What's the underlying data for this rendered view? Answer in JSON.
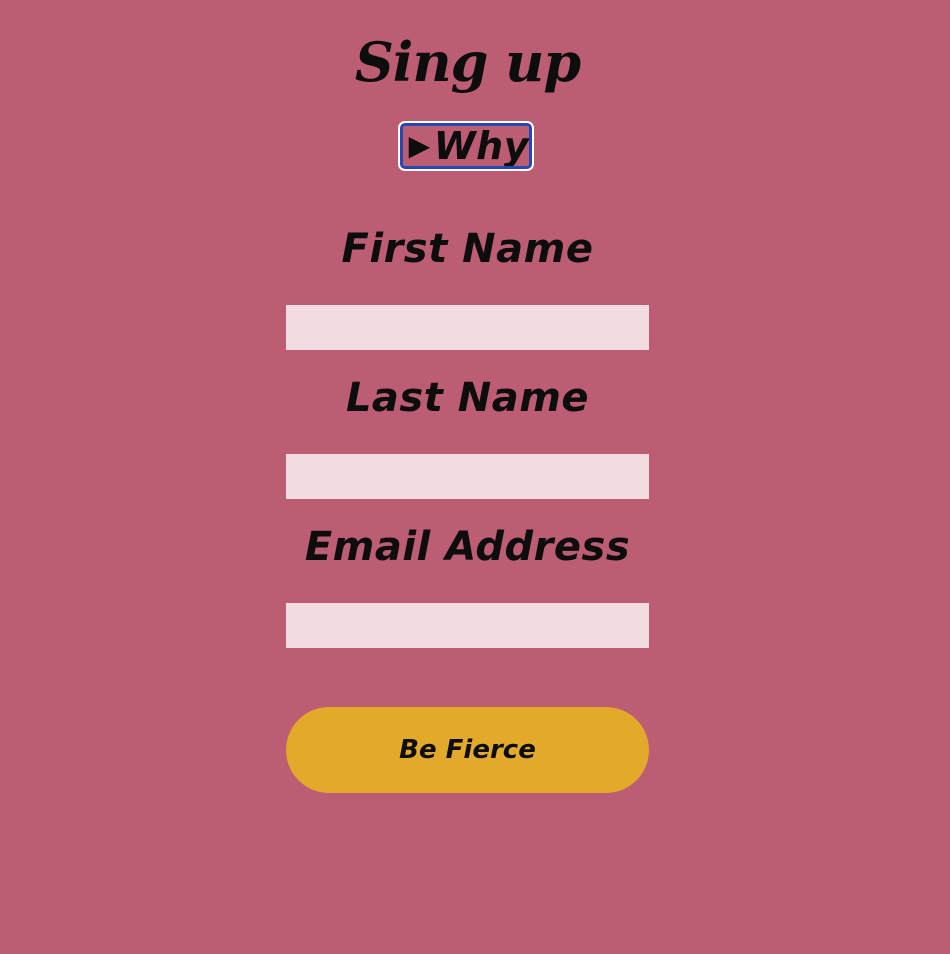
{
  "header": {
    "title": "Sing up"
  },
  "disclosure": {
    "arrow_glyph": "▶",
    "label": "Why"
  },
  "form": {
    "first_name": {
      "label": "First Name",
      "value": "",
      "placeholder": ""
    },
    "last_name": {
      "label": "Last Name",
      "value": "",
      "placeholder": ""
    },
    "email": {
      "label": "Email Address",
      "value": "",
      "placeholder": ""
    },
    "submit_label": "Be Fierce"
  },
  "colors": {
    "background": "#bc5d74",
    "input_fill": "#f2dce2",
    "button_fill": "#e3a92a",
    "focus_ring": "#2548b6",
    "text": "#0d0d0d"
  }
}
